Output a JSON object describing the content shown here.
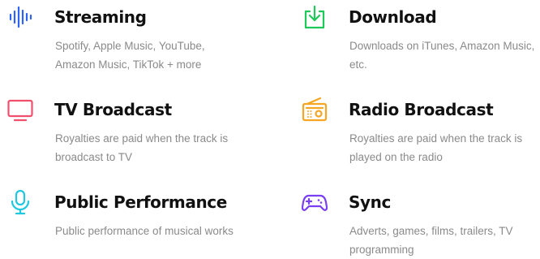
{
  "colors": {
    "streaming": "#2f63f6",
    "download": "#1ec95a",
    "tv": "#f0506e",
    "radio": "#f6a623",
    "public": "#20c8e0",
    "sync": "#7a3ff2",
    "title": "#111111",
    "description": "#8a8a8a"
  },
  "features": {
    "streaming": {
      "icon": "sound-wave-icon",
      "title": "Streaming",
      "description": "Spotify, Apple Music, YouTube, Amazon Music, TikTok + more"
    },
    "download": {
      "icon": "download-icon",
      "title": "Download",
      "description": "Downloads on iTunes, Amazon Music, etc."
    },
    "tv": {
      "icon": "tv-icon",
      "title": "TV Broadcast",
      "description": "Royalties are paid when the track is broadcast to TV"
    },
    "radio": {
      "icon": "radio-icon",
      "title": "Radio Broadcast",
      "description": "Royalties are paid when the track is played on the radio"
    },
    "public": {
      "icon": "microphone-icon",
      "title": "Public Performance",
      "description": "Public performance of musical works"
    },
    "sync": {
      "icon": "gamepad-icon",
      "title": "Sync",
      "description": "Adverts, games, films, trailers, TV programming"
    }
  }
}
